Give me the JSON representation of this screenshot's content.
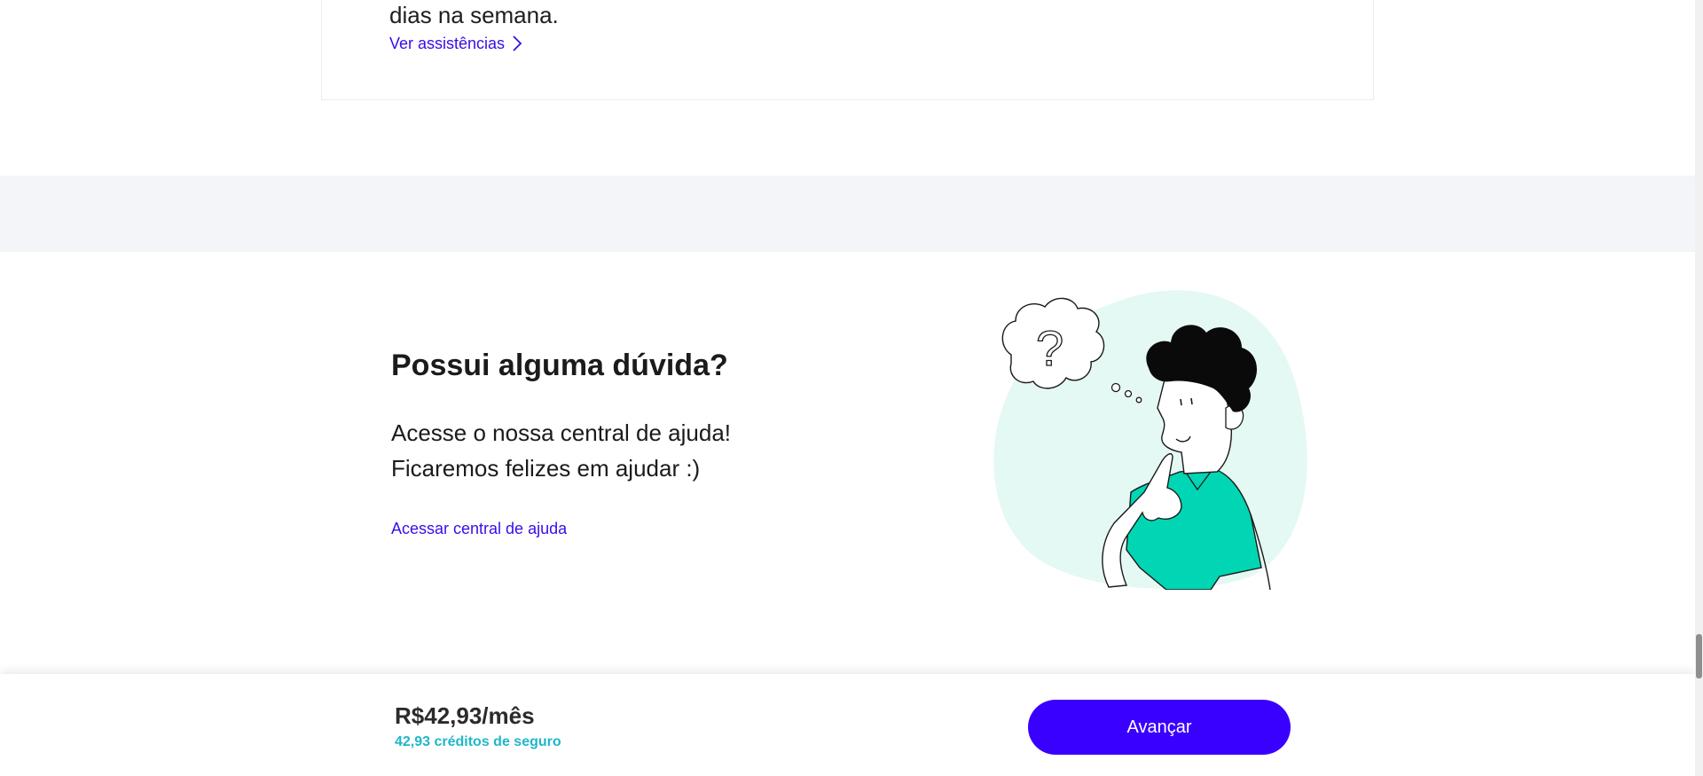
{
  "top_card": {
    "text_fragment": "dias na semana.",
    "link_label": "Ver assistências"
  },
  "help_section": {
    "title": "Possui alguma dúvida?",
    "description_line1": "Acesse o nossa central de ajuda!",
    "description_line2": "Ficaremos felizes em ajudar :)",
    "link_label": "Acessar central de ajuda",
    "illustration_question": "?"
  },
  "footer_bar": {
    "price": "R$42,93/mês",
    "credits": "42,93 créditos de seguro",
    "advance_label": "Avançar"
  },
  "colors": {
    "accent": "#3a00ff",
    "link": "#3a0ce8",
    "credits": "#1fb7c9",
    "blob": "#e4f8f4",
    "shirt": "#00d6b4"
  }
}
